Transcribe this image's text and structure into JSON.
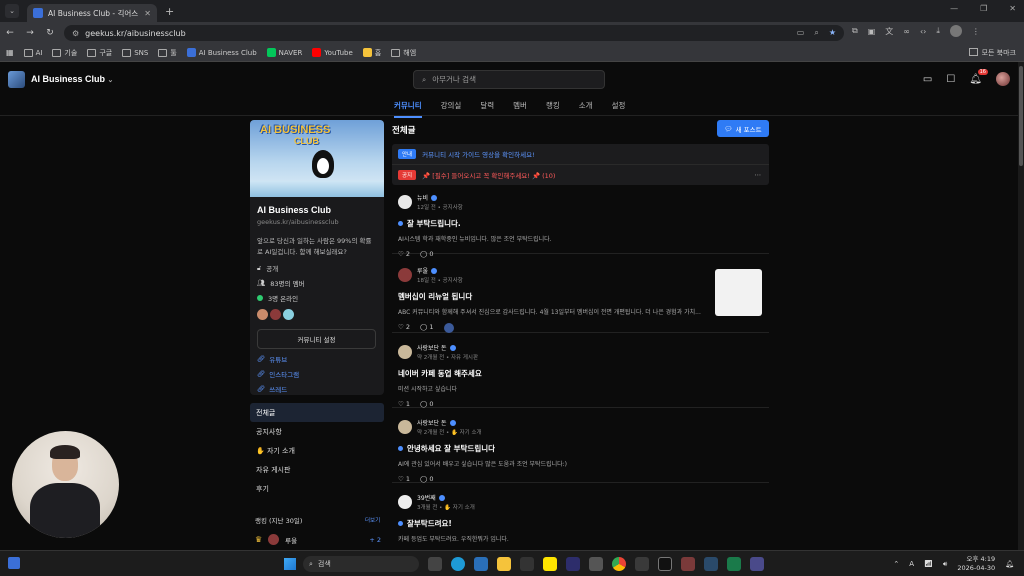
{
  "browser": {
    "tab_title": "AI Business Club - 긱어스",
    "url": "geekus.kr/aibusinessclub",
    "bookmarks": [
      {
        "label": "AI"
      },
      {
        "label": "기술"
      },
      {
        "label": "구글"
      },
      {
        "label": "SNS"
      },
      {
        "label": "툴"
      },
      {
        "label": "AI Business Club"
      },
      {
        "label": "NAVER"
      },
      {
        "label": "YouTube"
      },
      {
        "label": "홈"
      },
      {
        "label": "해엠"
      }
    ],
    "all_bookmarks": "모든 북마크"
  },
  "header": {
    "site_name": "AI Business Club",
    "search_placeholder": "아무거나 검색",
    "notification_count": "16"
  },
  "nav": {
    "tabs": [
      {
        "label": "커뮤니티",
        "active": true
      },
      {
        "label": "강의실"
      },
      {
        "label": "달력"
      },
      {
        "label": "멤버"
      },
      {
        "label": "랭킹"
      },
      {
        "label": "소개"
      },
      {
        "label": "설정"
      }
    ]
  },
  "sidebar": {
    "club_title": "AI Business Club",
    "club_url": "geekus.kr/aibusinessclub",
    "description": "앞으로 당신과 일하는 사람은 99%의 확률로 AI일겁니다. 함께 해보실래요?",
    "visibility": "공개",
    "members": "83명의 멤버",
    "online": "3명 온라인",
    "settings_button": "커뮤니티 설정",
    "links": [
      "유튜브",
      "인스타그램",
      "쓰레드"
    ],
    "menu": [
      {
        "label": "전체글",
        "active": true
      },
      {
        "label": "공지사항"
      },
      {
        "label": "✋ 자기 소개"
      },
      {
        "label": "자유 게시판"
      },
      {
        "label": "후기"
      }
    ],
    "ranking_title": "랭킹 (지난 30일)",
    "ranking_more": "더보기",
    "ranking_top": {
      "name": "루울",
      "points": "+ 2"
    }
  },
  "feed": {
    "title": "전체글",
    "new_post_button": "새 포스트",
    "notices": [
      {
        "tag": "안내",
        "text": "커뮤니티 시작 가이드 영상을 확인하세요!"
      },
      {
        "tag": "공지",
        "text": "📌 [필수] 들어오시고 꼭 확인해주세요! 📌 (10)"
      }
    ],
    "posts": [
      {
        "author": "뉴비",
        "meta": "12일 전 • 공지사항",
        "title": "잘 부탁드립니다.",
        "body": "AI시스템 학과 재학중인 뉴비입니다. 많은 조언 부탁드립니다.",
        "likes": "2",
        "comments": "0",
        "avatar_color": "#e8e8e8"
      },
      {
        "author": "루울",
        "meta": "18일 전 • 공지사항",
        "title": "멤버십이 리뉴얼 됩니다",
        "body": "ABC 커뮤니티와 함께해 주셔서 진심으로 감사드립니다. 4월 13일부터 멤버십이 전면 개편됩니다. 더 나은 경험과 가치...",
        "likes": "2",
        "comments": "1",
        "avatar_color": "#8b3a3a"
      },
      {
        "author": "사랑보단 돈",
        "meta": "약 2개월 전 • 자유 게시판",
        "title": "네이버 카페 동업 해주세요",
        "body": "미션 시작하고 싶습니다",
        "likes": "1",
        "comments": "0",
        "avatar_color": "#c9b89a"
      },
      {
        "author": "사랑보단 돈",
        "meta": "약 2개월 전 • ✋ 자기 소개",
        "title": "안녕하세요 잘 부탁드립니다",
        "body": "AI에 관심 있어서 배우고 싶습니다 많은 도움과 조언 부탁드립니다:)",
        "likes": "1",
        "comments": "0",
        "avatar_color": "#c9b89a"
      },
      {
        "author": "39번째",
        "meta": "3개월 전 • ✋ 자기 소개",
        "title": "잘부탁드려요!",
        "body": "카페 등업도 부탁드려요. 우직한뭐가 입니다.",
        "likes": "1",
        "comments": "0",
        "avatar_color": "#eeeeee"
      }
    ]
  },
  "taskbar": {
    "search": "검색",
    "time": "오후 4:19",
    "date": "2026-04-30"
  }
}
